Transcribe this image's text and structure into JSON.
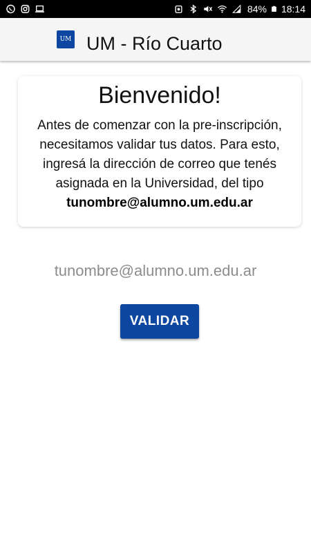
{
  "status_bar": {
    "battery_percent": "84%",
    "time": "18:14",
    "left_icons": [
      "whatsapp-icon",
      "instagram-icon",
      "laptop-icon"
    ],
    "right_icons": [
      "alarm-icon",
      "bluetooth-icon",
      "mute-icon",
      "wifi-icon",
      "signal-icon",
      "battery-icon"
    ]
  },
  "app_bar": {
    "logo_text": "UM",
    "title": "UM - Río Cuarto",
    "logo_color": "#0d47a1"
  },
  "welcome_card": {
    "title": "Bienvenido!",
    "body": "Antes de comenzar con la pre-inscripción, necesitamos validar tus datos. Para esto, ingresá la dirección de correo que tenés asignada en la Universidad, del tipo",
    "example_email": "tunombre@alumno.um.edu.ar"
  },
  "email_input": {
    "placeholder": "tunombre@alumno.um.edu.ar",
    "value": ""
  },
  "validate_button": {
    "label": "VALIDAR",
    "color": "#0d47a1"
  }
}
